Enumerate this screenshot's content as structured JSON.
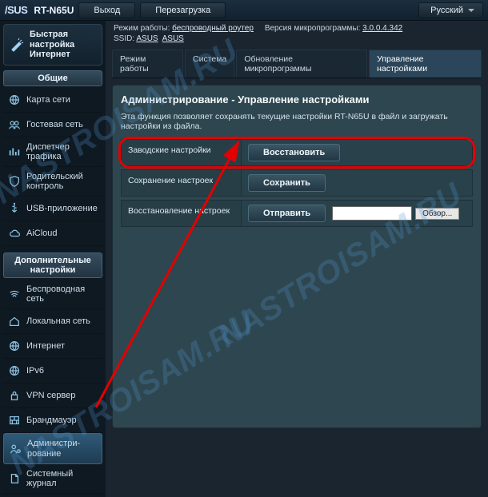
{
  "brand": "/SUS",
  "model": "RT-N65U",
  "top_buttons": {
    "logout": "Выход",
    "reboot": "Перезагрузка"
  },
  "lang": "Русский",
  "mode_line": {
    "prefix": "Режим работы: ",
    "mode": "беспроводный роутер",
    "fw_prefix": "Версия микропрограммы: ",
    "fw": "3.0.0.4.342"
  },
  "ssid_line": {
    "prefix": "SSID: ",
    "v1": "ASUS",
    "v2": "ASUS"
  },
  "qis_label": "Быстрая настройка\nИнтернет",
  "section_general": "Общие",
  "section_advanced": "Дополнительные\nнастройки",
  "nav_general": [
    "Карта сети",
    "Гостевая сеть",
    "Диспетчер трафика",
    "Родительский контроль",
    "USB-приложение",
    "AiCloud"
  ],
  "nav_advanced": [
    "Беспроводная сеть",
    "Локальная сеть",
    "Интернет",
    "IPv6",
    "VPN сервер",
    "Брандмауэр",
    "Администри-\nрование",
    "Системный журнал"
  ],
  "tabs": [
    "Режим работы",
    "Система",
    "Обновление микропрограммы",
    "Управление настройками"
  ],
  "active_tab": 3,
  "panel": {
    "title": "Администрирование - Управление настройками",
    "desc": "Эта функция позволяет сохранять текущие настройки RT-N65U в файл и загружать настройки из файла.",
    "rows": {
      "factory": {
        "label": "Заводские настройки",
        "btn": "Восстановить"
      },
      "save": {
        "label": "Сохранение настроек",
        "btn": "Сохранить"
      },
      "restore": {
        "label": "Восстановление настроек",
        "btn": "Отправить",
        "browse": "Обзор..."
      }
    }
  },
  "watermark": "NASTROISAM.RU"
}
